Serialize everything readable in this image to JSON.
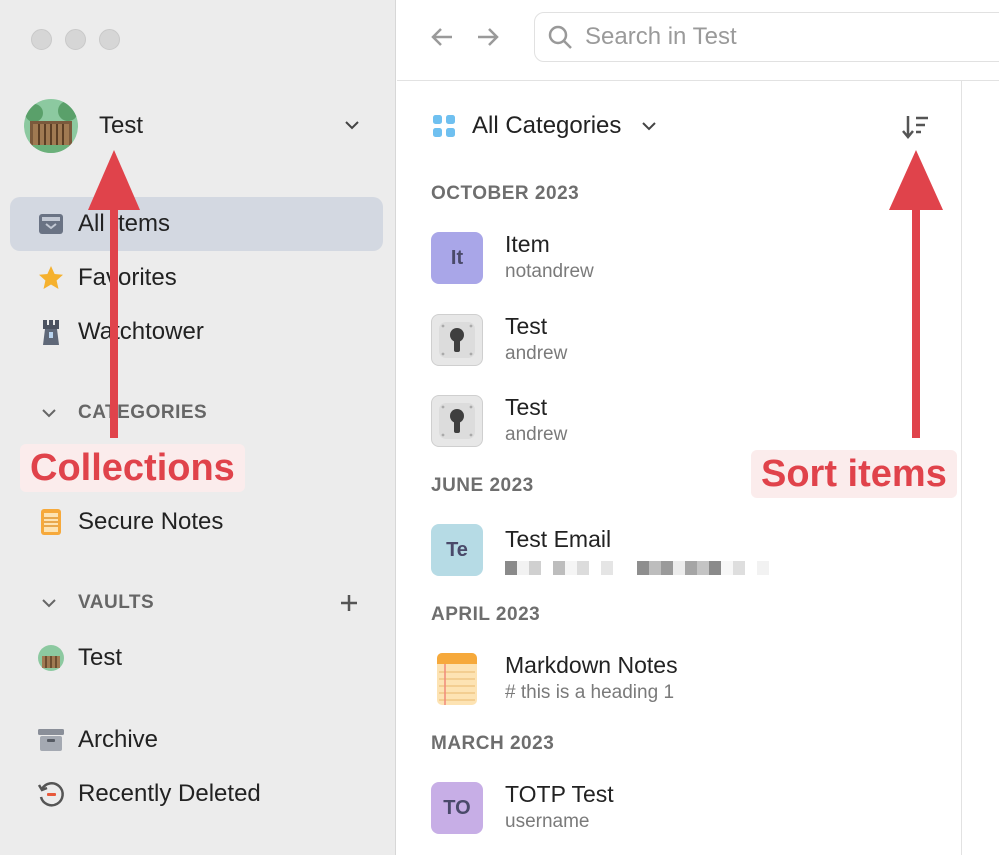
{
  "window": {
    "controls": [
      "close",
      "minimize",
      "zoom"
    ]
  },
  "account": {
    "name": "Test"
  },
  "sidebar": {
    "items": [
      {
        "label": "All Items",
        "icon": "all-items-icon",
        "active": true
      },
      {
        "label": "Favorites",
        "icon": "star-icon"
      },
      {
        "label": "Watchtower",
        "icon": "watchtower-icon"
      }
    ],
    "categories_heading": "CATEGORIES",
    "categories": [
      {
        "label": "Secure Notes",
        "icon": "secure-notes-icon"
      }
    ],
    "vaults_heading": "VAULTS",
    "vaults": [
      {
        "label": "Test",
        "icon": "vault-avatar-icon"
      }
    ],
    "bottom": [
      {
        "label": "Archive",
        "icon": "archive-icon"
      },
      {
        "label": "Recently Deleted",
        "icon": "recently-deleted-icon"
      }
    ]
  },
  "toolbar": {
    "search_placeholder": "Search in Test"
  },
  "list": {
    "filter_label": "All Categories",
    "groups": [
      {
        "heading": "OCTOBER 2023",
        "items": [
          {
            "title": "Item",
            "subtitle": "notandrew",
            "badge": "It",
            "badge_color": "#a9a6e8"
          },
          {
            "title": "Test",
            "subtitle": "andrew",
            "icon": "keyhole-icon"
          },
          {
            "title": "Test",
            "subtitle": "andrew",
            "icon": "keyhole-icon"
          }
        ]
      },
      {
        "heading": "JUNE 2023",
        "items": [
          {
            "title": "Test Email",
            "subtitle_redacted": true,
            "badge": "Te",
            "badge_color": "#b6dbe5"
          }
        ]
      },
      {
        "heading": "APRIL 2023",
        "items": [
          {
            "title": "Markdown Notes",
            "subtitle": "# this is a heading 1",
            "icon": "notepad-icon"
          }
        ]
      },
      {
        "heading": "MARCH 2023",
        "items": [
          {
            "title": "TOTP Test",
            "subtitle": "username",
            "badge": "TO",
            "badge_color": "#c7aee6"
          }
        ]
      }
    ]
  },
  "annotations": {
    "collections_label": "Collections",
    "sort_label": "Sort items",
    "color": "#e0434b"
  }
}
